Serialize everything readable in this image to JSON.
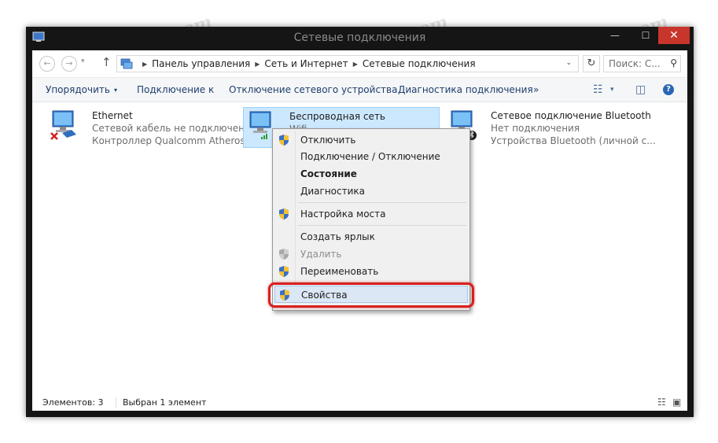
{
  "window": {
    "title": "Сетевые подключения",
    "controls": {
      "minimize": "—",
      "maximize": "☐",
      "close": "✕"
    }
  },
  "address_bar": {
    "breadcrumbs": [
      "Панель управления",
      "Сеть и Интернет",
      "Сетевые подключения"
    ],
    "search_placeholder": "Поиск: С...",
    "back": "←",
    "forward": "→",
    "dropdown": "▾",
    "up": "↑",
    "refresh": "↻",
    "addr_dropdown": "⌄",
    "search_icon": "⚲"
  },
  "toolbar": {
    "organize": "Упорядочить",
    "organize_caret": "▾",
    "connect": "Подключение к",
    "disable": "Отключение сетевого устройства",
    "diagnose": "Диагностика подключения",
    "more": "»",
    "view_icon": "☷",
    "view_caret": "▾",
    "pane_icon": "◫",
    "help": "?"
  },
  "connections": [
    {
      "name": "Ethernet",
      "status": "Сетевой кабель не подключен",
      "device": "Контроллер Qualcomm Atheros ...",
      "state": "disconnected"
    },
    {
      "name": "Беспроводная сеть",
      "status": "Wifi",
      "device": "",
      "state": "selected"
    },
    {
      "name": "Сетевое подключение Bluetooth",
      "status": "Нет подключения",
      "device": "Устройства Bluetooth (личной с...",
      "state": "bluetooth"
    }
  ],
  "context_menu": {
    "items": [
      {
        "label": "Отключить",
        "shield": true,
        "style": "normal"
      },
      {
        "label": "Подключение / Отключение",
        "shield": false,
        "style": "normal"
      },
      {
        "label": "Состояние",
        "shield": false,
        "style": "bold"
      },
      {
        "label": "Диагностика",
        "shield": false,
        "style": "normal"
      },
      {
        "label": "Настройка моста",
        "shield": true,
        "style": "normal"
      },
      {
        "label": "Создать ярлык",
        "shield": false,
        "style": "normal"
      },
      {
        "label": "Удалить",
        "shield": true,
        "style": "disabled"
      },
      {
        "label": "Переименовать",
        "shield": true,
        "style": "normal"
      },
      {
        "label": "Свойства",
        "shield": true,
        "style": "highlight"
      }
    ]
  },
  "status_bar": {
    "items_count": "Элементов: 3",
    "selected": "Выбран 1 элемент",
    "details_icon": "☷",
    "tiles_icon": "▣"
  },
  "watermark": "Sovingpcrepair.com",
  "icons": [
    "window-icon",
    "back-arrow-icon",
    "forward-arrow-icon",
    "up-arrow-icon",
    "control-panel-icon",
    "refresh-icon",
    "search-icon",
    "network-computer-icon",
    "uac-shield-icon",
    "bluetooth-icon",
    "help-icon"
  ],
  "colors": {
    "accent_selection": "#cce8ff",
    "highlight_border": "#d81f1f",
    "close_button": "#c7352b",
    "toolbar_text": "#1e3e6e"
  }
}
